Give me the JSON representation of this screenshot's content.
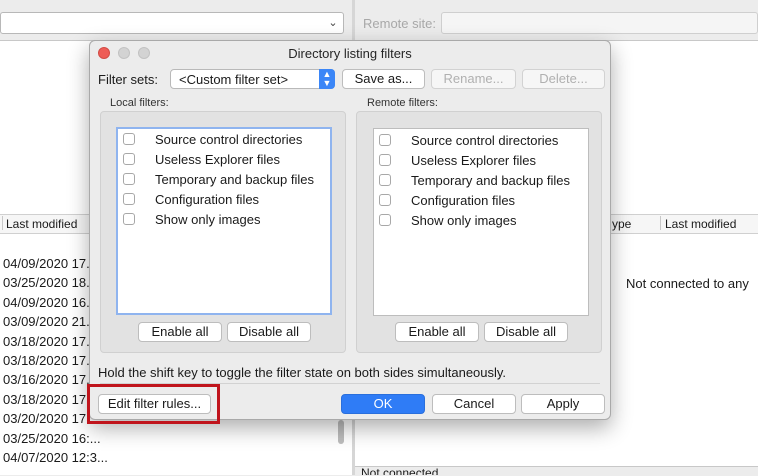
{
  "background": {
    "remote_site_label": "Remote site:",
    "local_column_header": "Last modified",
    "remote_columns": [
      "ype",
      "Last modified"
    ],
    "local_dates": [
      "04/09/2020 17...",
      "03/25/2020 18...",
      "04/09/2020 16...",
      "03/09/2020 21...",
      "03/18/2020 17...",
      "03/18/2020 17...",
      "03/16/2020 17...",
      "03/18/2020 17...",
      "03/20/2020 17...",
      "03/25/2020 16:...",
      "04/07/2020 12:3..."
    ],
    "remote_status": "Not connected to any",
    "status_bar": "Not connected"
  },
  "dialog": {
    "title": "Directory listing filters",
    "filter_sets_label": "Filter sets:",
    "filter_set_value": "<Custom filter set>",
    "save_as": "Save as...",
    "rename": "Rename...",
    "delete": "Delete...",
    "local_filters_label": "Local filters:",
    "remote_filters_label": "Remote filters:",
    "filters": [
      {
        "label": "Source control directories",
        "checked": false
      },
      {
        "label": "Useless Explorer files",
        "checked": false
      },
      {
        "label": "Temporary and backup files",
        "checked": false
      },
      {
        "label": "Configuration files",
        "checked": false
      },
      {
        "label": "Show only images",
        "checked": false
      }
    ],
    "enable_all": "Enable all",
    "disable_all": "Disable all",
    "hint": "Hold the shift key to toggle the filter state on both sides simultaneously.",
    "edit_filter_rules": "Edit filter rules...",
    "ok": "OK",
    "cancel": "Cancel",
    "apply": "Apply"
  },
  "colors": {
    "accent": "#2f7cf6",
    "highlight_box": "#c0141c",
    "close_button": "#ee5c56"
  }
}
